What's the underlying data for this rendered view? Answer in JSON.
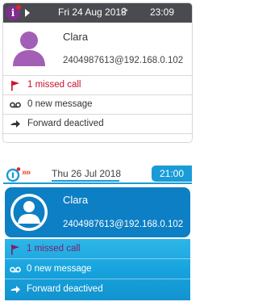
{
  "phone_dark": {
    "status": {
      "date": "Fri 24 Aug 2018",
      "time": "23:09",
      "info_glyph": "i"
    },
    "user": {
      "name": "Clara",
      "address": "2404987613@192.168.0.102"
    },
    "rows": [
      {
        "label": "1 missed call",
        "icon": "flag-icon"
      },
      {
        "label": "0 new message",
        "icon": "voicemail-icon"
      },
      {
        "label": "Forward deactived",
        "icon": "arrow-right-icon"
      }
    ]
  },
  "phone_light": {
    "status": {
      "date": "Thu 26 Jul 2018",
      "time": "21:00",
      "chevrons": "»»"
    },
    "user": {
      "name": "Clara",
      "address": "2404987613@192.168.0.102"
    },
    "rows": [
      {
        "label": "1 missed call",
        "icon": "flag-icon"
      },
      {
        "label": "0 new message",
        "icon": "voicemail-icon"
      },
      {
        "label": "Forward deactived",
        "icon": "arrow-right-icon"
      }
    ]
  },
  "colors": {
    "dark_status_bar": "#4a4b51",
    "accent_purple": "#7f2d8f",
    "missed_call_red": "#c8102e",
    "accent_blue": "#1a9bd7",
    "user_card_blue": "#0d7fc4"
  }
}
